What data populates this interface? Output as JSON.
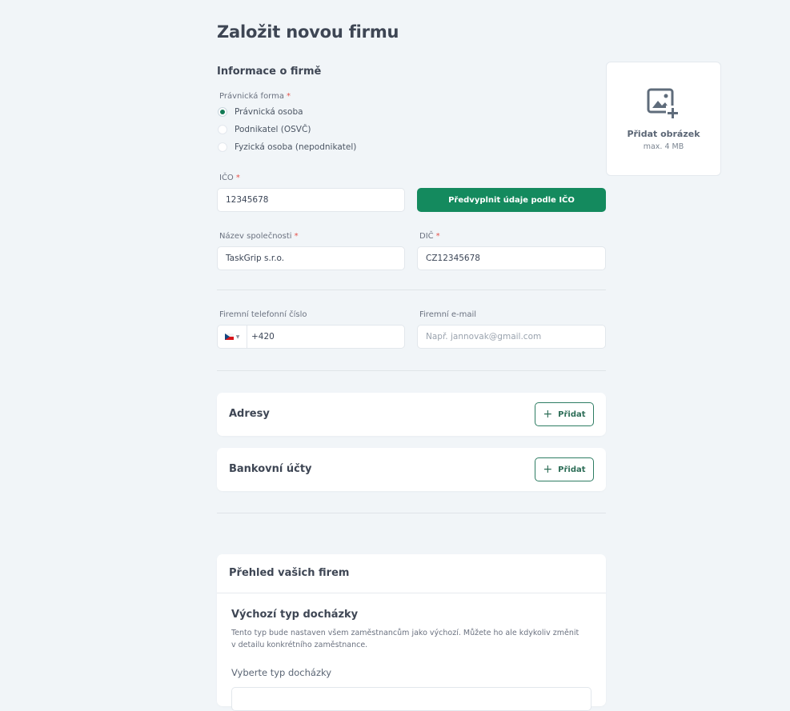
{
  "page": {
    "title": "Založit novou firmu"
  },
  "company_info": {
    "section_title": "Informace o firmě",
    "legal_form": {
      "label": "Právnická forma",
      "required_mark": "*",
      "options": [
        {
          "label": "Právnická osoba",
          "selected": true
        },
        {
          "label": "Podnikatel (OSVČ)",
          "selected": false
        },
        {
          "label": "Fyzická osoba (nepodnikatel)",
          "selected": false
        }
      ]
    },
    "ico": {
      "label": "IČO",
      "required_mark": "*",
      "value": "12345678"
    },
    "prefill_button": "Předvyplnit údaje podle IČO",
    "company_name": {
      "label": "Název společnosti",
      "required_mark": "*",
      "value": "TaskGrip s.r.o."
    },
    "dic": {
      "label": "DIČ",
      "required_mark": "*",
      "value": "CZ12345678"
    },
    "phone": {
      "label": "Firemní telefonní číslo",
      "country_flag": "czech-flag-icon",
      "value": "+420"
    },
    "email": {
      "label": "Firemní e-mail",
      "placeholder": "Např. jannovak@gmail.com"
    }
  },
  "image_upload": {
    "label": "Přidat obrázek",
    "hint": "max. 4 MB",
    "icon": "add-image-icon"
  },
  "addresses": {
    "title": "Adresy",
    "add_button": "Přidat",
    "add_icon": "plus-icon"
  },
  "bank_accounts": {
    "title": "Bankovní účty",
    "add_button": "Přidat",
    "add_icon": "plus-icon"
  },
  "overview": {
    "title": "Přehled vašich firem",
    "attendance": {
      "title": "Výchozí typ docházky",
      "description": "Tento typ bude nastaven všem zaměstnancům jako výchozí. Můžete ho ale kdykoliv změnit v detailu konkrétního zaměstnance.",
      "select_label": "Vyberte typ docházky"
    }
  },
  "colors": {
    "primary": "#148a5e",
    "outline": "#2e7d63",
    "required": "#e5534b",
    "background": "#f1f5f8"
  }
}
